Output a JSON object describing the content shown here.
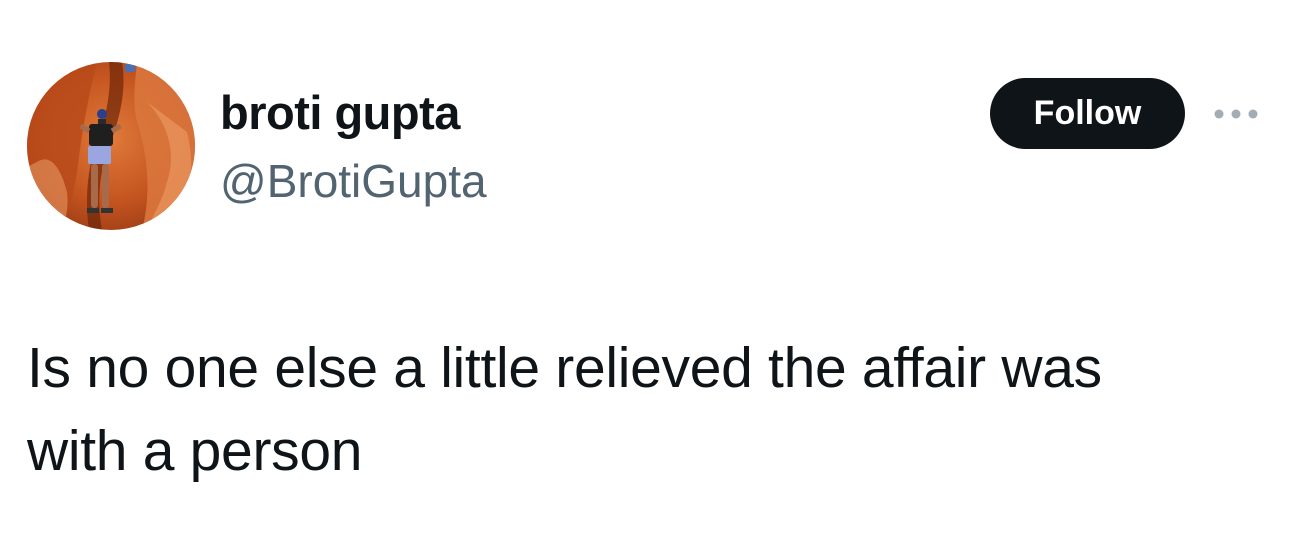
{
  "author": {
    "display_name": "broti gupta",
    "handle": "@BrotiGupta",
    "avatar_icon": "profile-photo"
  },
  "actions": {
    "follow_label": "Follow",
    "more_icon": "more-horizontal-icon"
  },
  "tweet": {
    "text_lines": [
      "Is no one else a little relieved the affair was",
      "with a person"
    ]
  },
  "colors": {
    "text_primary": "#0f1419",
    "text_secondary": "#536471",
    "button_bg": "#0f1419",
    "button_text": "#ffffff",
    "more_dots": "#a3adb6"
  }
}
